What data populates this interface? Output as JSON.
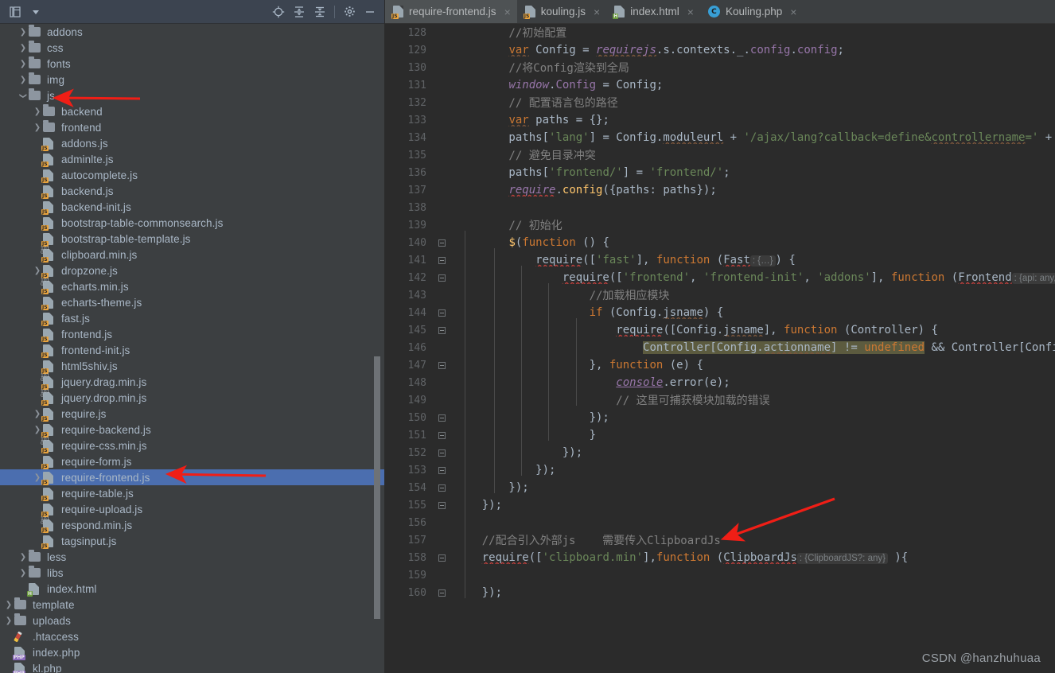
{
  "project_panel": {
    "toolbar": {
      "icons": [
        {
          "name": "project-menu-icon",
          "glyph": "☰"
        },
        {
          "name": "chevron-down-icon",
          "glyph": "▾"
        },
        {
          "name": "locate-target-icon",
          "glyph": "⊕"
        },
        {
          "name": "expand-all-icon",
          "glyph": "≡"
        },
        {
          "name": "collapse-all-icon",
          "glyph": "≡"
        },
        {
          "name": "gear-icon",
          "glyph": "⚙"
        },
        {
          "name": "minimize-icon",
          "glyph": "—"
        }
      ]
    },
    "tree": [
      {
        "label": "addons",
        "indent": 1,
        "arrow": "right",
        "icon": "folder"
      },
      {
        "label": "css",
        "indent": 1,
        "arrow": "right",
        "icon": "folder"
      },
      {
        "label": "fonts",
        "indent": 1,
        "arrow": "right",
        "icon": "folder"
      },
      {
        "label": "img",
        "indent": 1,
        "arrow": "right",
        "icon": "folder"
      },
      {
        "label": "js",
        "indent": 1,
        "arrow": "down",
        "icon": "folder"
      },
      {
        "label": "backend",
        "indent": 2,
        "arrow": "right",
        "icon": "folder"
      },
      {
        "label": "frontend",
        "indent": 2,
        "arrow": "right",
        "icon": "folder"
      },
      {
        "label": "addons.js",
        "indent": 2,
        "arrow": "none",
        "icon": "js"
      },
      {
        "label": "adminlte.js",
        "indent": 2,
        "arrow": "none",
        "icon": "js"
      },
      {
        "label": "autocomplete.js",
        "indent": 2,
        "arrow": "none",
        "icon": "js"
      },
      {
        "label": "backend.js",
        "indent": 2,
        "arrow": "none",
        "icon": "js"
      },
      {
        "label": "backend-init.js",
        "indent": 2,
        "arrow": "none",
        "icon": "js"
      },
      {
        "label": "bootstrap-table-commonsearch.js",
        "indent": 2,
        "arrow": "none",
        "icon": "js"
      },
      {
        "label": "bootstrap-table-template.js",
        "indent": 2,
        "arrow": "none",
        "icon": "js"
      },
      {
        "label": "clipboard.min.js",
        "indent": 2,
        "arrow": "none",
        "icon": "js-min"
      },
      {
        "label": "dropzone.js",
        "indent": 2,
        "arrow": "right",
        "icon": "js"
      },
      {
        "label": "echarts.min.js",
        "indent": 2,
        "arrow": "none",
        "icon": "js-min"
      },
      {
        "label": "echarts-theme.js",
        "indent": 2,
        "arrow": "none",
        "icon": "js"
      },
      {
        "label": "fast.js",
        "indent": 2,
        "arrow": "none",
        "icon": "js"
      },
      {
        "label": "frontend.js",
        "indent": 2,
        "arrow": "none",
        "icon": "js"
      },
      {
        "label": "frontend-init.js",
        "indent": 2,
        "arrow": "none",
        "icon": "js"
      },
      {
        "label": "html5shiv.js",
        "indent": 2,
        "arrow": "none",
        "icon": "js"
      },
      {
        "label": "jquery.drag.min.js",
        "indent": 2,
        "arrow": "none",
        "icon": "js-min"
      },
      {
        "label": "jquery.drop.min.js",
        "indent": 2,
        "arrow": "none",
        "icon": "js-min"
      },
      {
        "label": "require.js",
        "indent": 2,
        "arrow": "right",
        "icon": "js"
      },
      {
        "label": "require-backend.js",
        "indent": 2,
        "arrow": "right",
        "icon": "js"
      },
      {
        "label": "require-css.min.js",
        "indent": 2,
        "arrow": "none",
        "icon": "js-min"
      },
      {
        "label": "require-form.js",
        "indent": 2,
        "arrow": "none",
        "icon": "js"
      },
      {
        "label": "require-frontend.js",
        "indent": 2,
        "arrow": "right",
        "icon": "js",
        "selected": true
      },
      {
        "label": "require-table.js",
        "indent": 2,
        "arrow": "none",
        "icon": "js"
      },
      {
        "label": "require-upload.js",
        "indent": 2,
        "arrow": "none",
        "icon": "js"
      },
      {
        "label": "respond.min.js",
        "indent": 2,
        "arrow": "none",
        "icon": "js-min"
      },
      {
        "label": "tagsinput.js",
        "indent": 2,
        "arrow": "none",
        "icon": "js"
      },
      {
        "label": "less",
        "indent": 1,
        "arrow": "right",
        "icon": "folder"
      },
      {
        "label": "libs",
        "indent": 1,
        "arrow": "right",
        "icon": "folder"
      },
      {
        "label": "index.html",
        "indent": 1,
        "arrow": "none",
        "icon": "html"
      },
      {
        "label": "template",
        "indent": 0,
        "arrow": "right",
        "icon": "folder"
      },
      {
        "label": "uploads",
        "indent": 0,
        "arrow": "right",
        "icon": "folder"
      },
      {
        "label": ".htaccess",
        "indent": 0,
        "arrow": "none",
        "icon": "htaccess"
      },
      {
        "label": "index.php",
        "indent": 0,
        "arrow": "none",
        "icon": "php"
      },
      {
        "label": "kl.php",
        "indent": 0,
        "arrow": "none",
        "icon": "php"
      }
    ]
  },
  "editor": {
    "tabs": [
      {
        "label": "require-frontend.js",
        "icon": "js",
        "active": true,
        "close": "×"
      },
      {
        "label": "kouling.js",
        "icon": "js",
        "active": false,
        "close": "×"
      },
      {
        "label": "index.html",
        "icon": "html",
        "active": false,
        "close": "×"
      },
      {
        "label": "Kouling.php",
        "icon": "class",
        "active": false,
        "close": "×"
      }
    ],
    "first_line_number": 128,
    "lines": [
      {
        "n": 128,
        "fold": "none"
      },
      {
        "n": 129,
        "fold": "none"
      },
      {
        "n": 130,
        "fold": "none"
      },
      {
        "n": 131,
        "fold": "none"
      },
      {
        "n": 132,
        "fold": "none"
      },
      {
        "n": 133,
        "fold": "none"
      },
      {
        "n": 134,
        "fold": "none"
      },
      {
        "n": 135,
        "fold": "none"
      },
      {
        "n": 136,
        "fold": "none"
      },
      {
        "n": 137,
        "fold": "none"
      },
      {
        "n": 138,
        "fold": "none"
      },
      {
        "n": 139,
        "fold": "none"
      },
      {
        "n": 140,
        "fold": "start"
      },
      {
        "n": 141,
        "fold": "start"
      },
      {
        "n": 142,
        "fold": "start"
      },
      {
        "n": 143,
        "fold": "none"
      },
      {
        "n": 144,
        "fold": "start"
      },
      {
        "n": 145,
        "fold": "start"
      },
      {
        "n": 146,
        "fold": "none"
      },
      {
        "n": 147,
        "fold": "end"
      },
      {
        "n": 148,
        "fold": "none"
      },
      {
        "n": 149,
        "fold": "none"
      },
      {
        "n": 150,
        "fold": "end"
      },
      {
        "n": 151,
        "fold": "end"
      },
      {
        "n": 152,
        "fold": "end"
      },
      {
        "n": 153,
        "fold": "end"
      },
      {
        "n": 154,
        "fold": "end"
      },
      {
        "n": 155,
        "fold": "end"
      },
      {
        "n": 156,
        "fold": "none"
      },
      {
        "n": 157,
        "fold": "none"
      },
      {
        "n": 158,
        "fold": "start"
      },
      {
        "n": 159,
        "fold": "none"
      },
      {
        "n": 160,
        "fold": "end"
      }
    ],
    "code_text": {
      "l128": "        //初始配置",
      "l129": "        var Config = requirejs.s.contexts._.config.config;",
      "l130": "        //将Config渲染到全局",
      "l131": "        window.Config = Config;",
      "l132": "        // 配置语言包的路径",
      "l133": "        var paths = {};",
      "l134": "        paths['lang'] = Config.moduleurl + '/ajax/lang?callback=define&controllername=' + Config.cont",
      "l135": "        // 避免目录冲突",
      "l136": "        paths['frontend/'] = 'frontend/';",
      "l137": "        require.config({paths: paths});",
      "l138": "",
      "l139": "        // 初始化",
      "l140": "        $(function () {",
      "l141": "            require(['fast'], function (Fast",
      "l141_inlay": ": {…}",
      "l141_tail": ") {",
      "l142": "                require(['frontend', 'frontend-init', 'addons'], function (Frontend",
      "l142_inlay": ": {api: any, init: function",
      "l143": "                    //加载相应模块",
      "l144": "                    if (Config.jsname) {",
      "l145": "                        require([Config.jsname], function (Controller) {",
      "l146_indent": "                            ",
      "l146_hl": "Controller[Config.actionname] != undefined",
      "l146_tail": " && Controller[Config.actionnam",
      "l147": "                    }, function (e) {",
      "l148": "                        console.error(e);",
      "l149": "                        // 这里可捕获模块加载的错误",
      "l150": "                    });",
      "l151": "                    }",
      "l152": "                });",
      "l153": "            });",
      "l154": "        });",
      "l155": "    });",
      "l156": "",
      "l157": "    //配合引入外部js    需要传入ClipboardJs",
      "l158": "    require(['clipboard.min'],function (ClipboardJs",
      "l158_inlay": ": {ClipboardJS?: any}",
      "l158_tail": " ){",
      "l159": "",
      "l160": "    });"
    }
  },
  "watermark": "CSDN @hanzhuhuaa",
  "annotations": {
    "arrow1_target": "js-folder-row",
    "arrow2_target": "require-frontend-js-row",
    "arrow3_target": "require-clipboard-line-158"
  },
  "colors": {
    "panel_bg": "#3c3f41",
    "editor_bg": "#2b2b2b",
    "selection_blue": "#4b6eaf",
    "arrow_red": "#f01e16",
    "accent_orange": "#cc7832",
    "string_green": "#6a8759",
    "text": "#a9b7c6"
  }
}
